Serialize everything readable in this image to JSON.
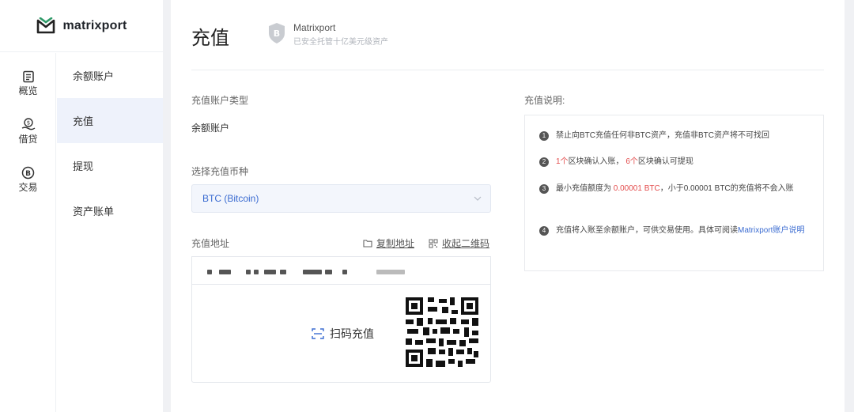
{
  "brand": {
    "name": "matrixport"
  },
  "nav": {
    "rail": [
      {
        "label": "概览",
        "icon": "overview-icon"
      },
      {
        "label": "借贷",
        "icon": "loan-icon"
      },
      {
        "label": "交易",
        "icon": "trade-icon"
      }
    ],
    "submenu": [
      {
        "label": "余额账户"
      },
      {
        "label": "充值",
        "active": true
      },
      {
        "label": "提现"
      },
      {
        "label": "资产账单"
      }
    ]
  },
  "header": {
    "title": "充值",
    "badge_name": "Matrixport",
    "badge_sub": "已安全托管十亿美元级资产"
  },
  "form": {
    "account_type_label": "充值账户类型",
    "account_type_value": "余额账户",
    "currency_label": "选择充值币种",
    "currency_value": "BTC (Bitcoin)",
    "address_label": "充值地址",
    "copy_address": "复制地址",
    "collapse_qr": "收起二维码",
    "scan_label": "扫码充值"
  },
  "notes": {
    "title": "充值说明:",
    "items": [
      {
        "num": "1",
        "text": "禁止向BTC充值任何非BTC资产，充值非BTC资产将不可找回"
      },
      {
        "num": "2",
        "a": "1个",
        "b": "区块确认入账， ",
        "c": "6个",
        "d": "区块确认可提现"
      },
      {
        "num": "3",
        "a": "最小充值额度为 ",
        "b": "0.00001 BTC",
        "c": "，小于0.00001 BTC的充值将不会入账"
      },
      {
        "num": "4",
        "a": "充值将入账至余额账户，可供交易使用。具体可阅读",
        "b": "Matrixport账户说明"
      }
    ]
  },
  "colors": {
    "accent": "#3a6bd1",
    "highlight": "#e34d4d",
    "active_bg": "#eef2fb",
    "brand_green": "#2e9a68"
  }
}
